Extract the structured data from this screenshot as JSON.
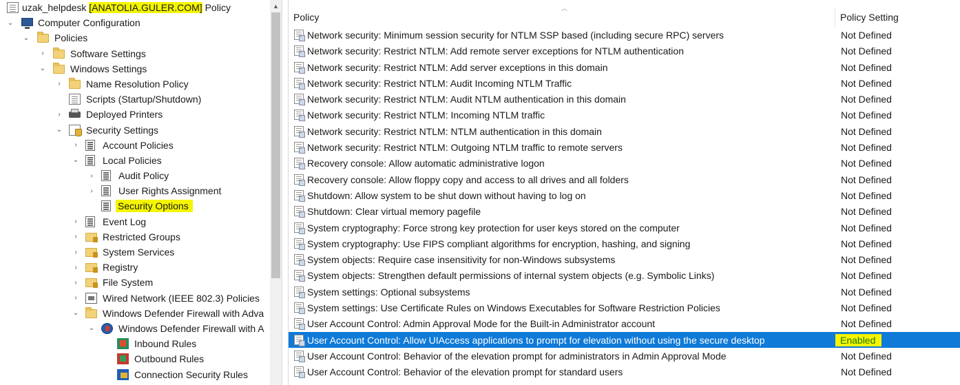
{
  "tree": {
    "root_label_prefix": "uzak_helpdesk ",
    "root_label_highlight": "[ANATOLIA.GULER.COM]",
    "root_label_suffix": " Policy",
    "nodes": [
      {
        "label": "Computer Configuration",
        "expander": "⌄",
        "icon": "computer-icon"
      },
      {
        "label": "Policies",
        "expander": "⌄",
        "icon": "folder-icon"
      },
      {
        "label": "Software Settings",
        "expander": "›",
        "icon": "folder-icon"
      },
      {
        "label": "Windows Settings",
        "expander": "⌄",
        "icon": "folder-icon"
      },
      {
        "label": "Name Resolution Policy",
        "expander": "›",
        "icon": "folder-icon"
      },
      {
        "label": "Scripts (Startup/Shutdown)",
        "expander": "",
        "icon": "script-icon"
      },
      {
        "label": "Deployed Printers",
        "expander": "›",
        "icon": "printer-icon"
      },
      {
        "label": "Security Settings",
        "expander": "⌄",
        "icon": "security-settings-icon"
      },
      {
        "label": "Account Policies",
        "expander": "›",
        "icon": "policy-sheet-icon"
      },
      {
        "label": "Local Policies",
        "expander": "⌄",
        "icon": "policy-sheet-icon"
      },
      {
        "label": "Audit Policy",
        "expander": "›",
        "icon": "policy-sheet-icon"
      },
      {
        "label": "User Rights Assignment",
        "expander": "›",
        "icon": "policy-sheet-icon"
      },
      {
        "label": "Security Options",
        "expander": "",
        "icon": "policy-sheet-icon"
      },
      {
        "label": "Event Log",
        "expander": "›",
        "icon": "policy-sheet-icon"
      },
      {
        "label": "Restricted Groups",
        "expander": "›",
        "icon": "locked-folder-icon"
      },
      {
        "label": "System Services",
        "expander": "›",
        "icon": "locked-folder-icon"
      },
      {
        "label": "Registry",
        "expander": "›",
        "icon": "locked-folder-icon"
      },
      {
        "label": "File System",
        "expander": "›",
        "icon": "locked-folder-icon"
      },
      {
        "label": "Wired Network (IEEE 802.3) Policies",
        "expander": "›",
        "icon": "network-icon"
      },
      {
        "label": "Windows Defender Firewall with Adva",
        "expander": "⌄",
        "icon": "folder-icon"
      },
      {
        "label": "Windows Defender Firewall with A",
        "expander": "⌄",
        "icon": "firewall-icon"
      },
      {
        "label": "Inbound Rules",
        "expander": "",
        "icon": "inbound-rules-icon"
      },
      {
        "label": "Outbound Rules",
        "expander": "",
        "icon": "outbound-rules-icon"
      },
      {
        "label": "Connection Security Rules",
        "expander": "",
        "icon": "connection-security-icon"
      }
    ]
  },
  "list": {
    "columns": {
      "policy": "Policy",
      "setting": "Policy Setting"
    },
    "rows": [
      {
        "policy": "Network security: Minimum session security for NTLM SSP based (including secure RPC) servers",
        "setting": "Not Defined"
      },
      {
        "policy": "Network security: Restrict NTLM: Add remote server exceptions for NTLM authentication",
        "setting": "Not Defined"
      },
      {
        "policy": "Network security: Restrict NTLM: Add server exceptions in this domain",
        "setting": "Not Defined"
      },
      {
        "policy": "Network security: Restrict NTLM: Audit Incoming NTLM Traffic",
        "setting": "Not Defined"
      },
      {
        "policy": "Network security: Restrict NTLM: Audit NTLM authentication in this domain",
        "setting": "Not Defined"
      },
      {
        "policy": "Network security: Restrict NTLM: Incoming NTLM traffic",
        "setting": "Not Defined"
      },
      {
        "policy": "Network security: Restrict NTLM: NTLM authentication in this domain",
        "setting": "Not Defined"
      },
      {
        "policy": "Network security: Restrict NTLM: Outgoing NTLM traffic to remote servers",
        "setting": "Not Defined"
      },
      {
        "policy": "Recovery console: Allow automatic administrative logon",
        "setting": "Not Defined"
      },
      {
        "policy": "Recovery console: Allow floppy copy and access to all drives and all folders",
        "setting": "Not Defined"
      },
      {
        "policy": "Shutdown: Allow system to be shut down without having to log on",
        "setting": "Not Defined"
      },
      {
        "policy": "Shutdown: Clear virtual memory pagefile",
        "setting": "Not Defined"
      },
      {
        "policy": "System cryptography: Force strong key protection for user keys stored on the computer",
        "setting": "Not Defined"
      },
      {
        "policy": "System cryptography: Use FIPS compliant algorithms for encryption, hashing, and signing",
        "setting": "Not Defined"
      },
      {
        "policy": "System objects: Require case insensitivity for non-Windows subsystems",
        "setting": "Not Defined"
      },
      {
        "policy": "System objects: Strengthen default permissions of internal system objects (e.g. Symbolic Links)",
        "setting": "Not Defined"
      },
      {
        "policy": "System settings: Optional subsystems",
        "setting": "Not Defined"
      },
      {
        "policy": "System settings: Use Certificate Rules on Windows Executables for Software Restriction Policies",
        "setting": "Not Defined"
      },
      {
        "policy": "User Account Control: Admin Approval Mode for the Built-in Administrator account",
        "setting": "Not Defined"
      },
      {
        "policy": "User Account Control: Allow UIAccess applications to prompt for elevation without using the secure desktop",
        "setting": "Enabled"
      },
      {
        "policy": "User Account Control: Behavior of the elevation prompt for administrators in Admin Approval Mode",
        "setting": "Not Defined"
      },
      {
        "policy": "User Account Control: Behavior of the elevation prompt for standard users",
        "setting": "Not Defined"
      }
    ]
  },
  "colors": {
    "selection": "#0f7ad8",
    "highlight": "#f5f500",
    "enabled_text": "#1a7a00"
  }
}
